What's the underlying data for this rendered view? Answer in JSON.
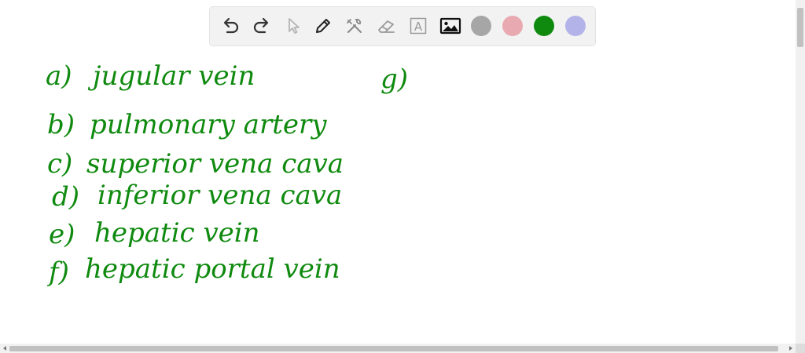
{
  "toolbar": {
    "tools": [
      {
        "name": "undo-icon"
      },
      {
        "name": "redo-icon"
      },
      {
        "name": "pointer-icon"
      },
      {
        "name": "pen-icon"
      },
      {
        "name": "tools-icon"
      },
      {
        "name": "eraser-icon"
      },
      {
        "name": "text-icon",
        "glyph": "A"
      },
      {
        "name": "image-icon"
      }
    ],
    "colors": {
      "gray": "#a6a6a6",
      "pink": "#e9a9b0",
      "green": "#0f8a0f",
      "lavender": "#b3b3e9"
    }
  },
  "notes": {
    "ink_color": "#0f8a0f",
    "lines": [
      {
        "marker": "a)",
        "text": "jugular vein"
      },
      {
        "marker": "b)",
        "text": "pulmonary artery"
      },
      {
        "marker": "c)",
        "text": "superior vena cava"
      },
      {
        "marker": "d)",
        "text": "inferior vena cava"
      },
      {
        "marker": "e)",
        "text": "hepatic vein"
      },
      {
        "marker": "f)",
        "text": "hepatic portal vein"
      },
      {
        "marker": "g)",
        "text": ""
      }
    ]
  }
}
